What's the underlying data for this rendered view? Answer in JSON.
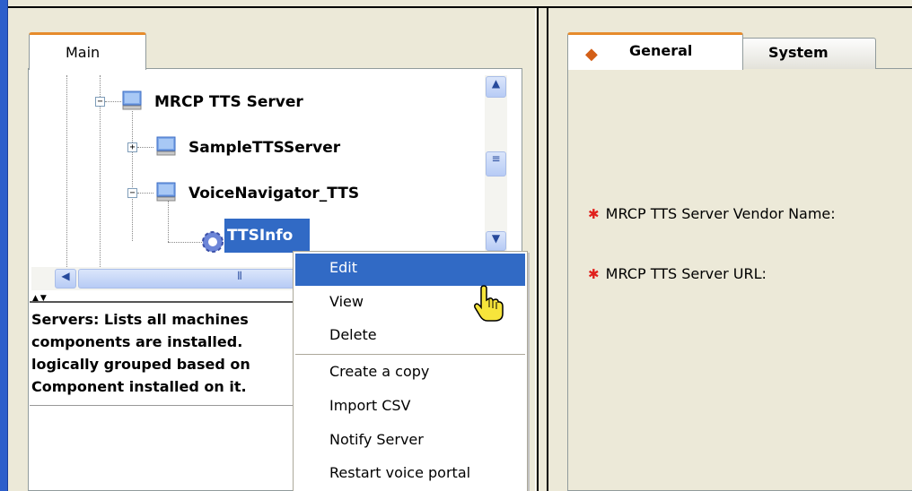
{
  "left_panel": {
    "tab_label": "Main",
    "tree": {
      "nodes": [
        {
          "label": "MRCP TTS Server",
          "expander": "−",
          "icon": "server-icon"
        },
        {
          "label": "SampleTTSServer",
          "expander": "+",
          "icon": "server-icon"
        },
        {
          "label": "VoiceNavigator_TTS",
          "expander": "−",
          "icon": "server-icon"
        },
        {
          "label": "TTSInfo",
          "icon": "gear-icon",
          "selected": true
        }
      ]
    },
    "description": {
      "lines": [
        "Servers: Lists all machines",
        "components are installed.",
        "logically grouped based on",
        "Component installed on it."
      ]
    }
  },
  "right_panel": {
    "tabs": [
      {
        "label": "General",
        "icon": "diamond-icon",
        "active": true
      },
      {
        "label": "System",
        "active": false
      }
    ],
    "fields": [
      {
        "label": "MRCP TTS Server Vendor Name:",
        "required_marker": "✱"
      },
      {
        "label": "MRCP TTS Server URL:",
        "required_marker": "✱"
      }
    ]
  },
  "context_menu": {
    "items": [
      {
        "label": "Edit",
        "highlighted": true
      },
      {
        "label": "View"
      },
      {
        "label": "Delete"
      },
      {
        "label": "Create a copy"
      },
      {
        "label": "Import CSV"
      },
      {
        "label": "Notify Server"
      },
      {
        "label": "Restart voice portal"
      }
    ]
  },
  "colors": {
    "selection": "#316ac5",
    "tab_accent": "#e68b2c",
    "required_star": "#e0201c",
    "window_bg": "#ece9d8"
  }
}
